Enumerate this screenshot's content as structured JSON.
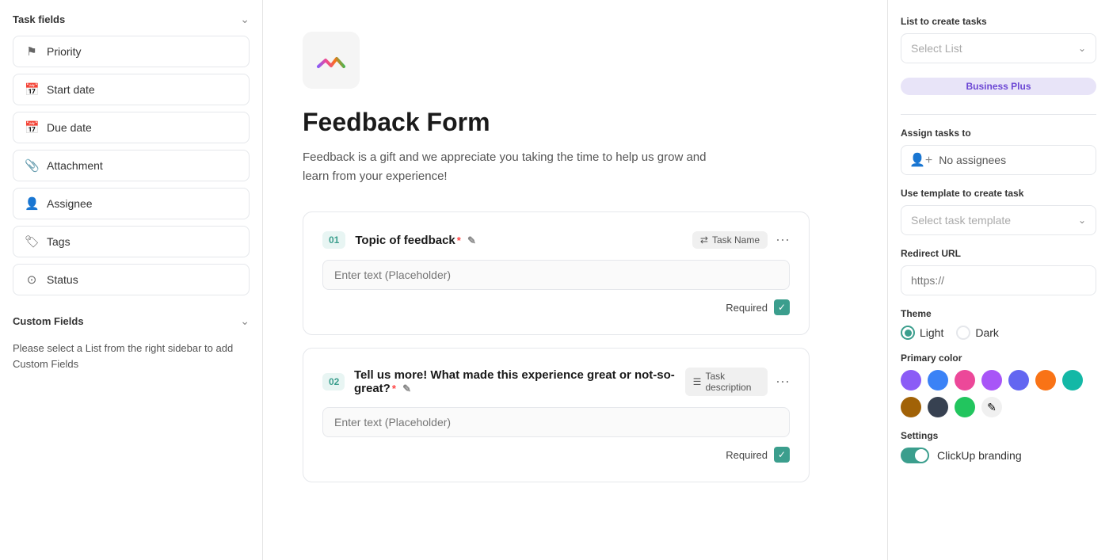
{
  "leftSidebar": {
    "taskFieldsLabel": "Task fields",
    "fields": [
      {
        "id": "priority",
        "label": "Priority",
        "icon": "⚑"
      },
      {
        "id": "start-date",
        "label": "Start date",
        "icon": "📅"
      },
      {
        "id": "due-date",
        "label": "Due date",
        "icon": "📅"
      },
      {
        "id": "attachment",
        "label": "Attachment",
        "icon": "📎"
      },
      {
        "id": "assignee",
        "label": "Assignee",
        "icon": "👤"
      },
      {
        "id": "tags",
        "label": "Tags",
        "icon": "🏷"
      },
      {
        "id": "status",
        "label": "Status",
        "icon": "⊙"
      }
    ],
    "customFieldsLabel": "Custom Fields",
    "customFieldsNote": "Please select a List from the right sidebar to add Custom Fields"
  },
  "main": {
    "formTitle": "Feedback Form",
    "formDescription": "Feedback is a gift and we appreciate you taking the time to help us grow and learn from your experience!",
    "questions": [
      {
        "number": "01",
        "title": "Topic of feedback",
        "required": true,
        "placeholder": "Enter text (Placeholder)",
        "badge": "Task Name",
        "badgeIcon": "⇄"
      },
      {
        "number": "02",
        "title": "Tell us more! What made this experience great or not-so-great?",
        "required": true,
        "placeholder": "Enter text (Placeholder)",
        "badge": "Task description",
        "badgeIcon": "☰"
      }
    ],
    "requiredLabel": "Required"
  },
  "rightSidebar": {
    "listLabel": "List to create tasks",
    "listPlaceholder": "Select List",
    "businessPlusBadge": "Business Plus",
    "assignLabel": "Assign tasks to",
    "noAssigneesLabel": "No assignees",
    "templateLabel": "Use template to create task",
    "templatePlaceholder": "Select task template",
    "redirectLabel": "Redirect URL",
    "redirectPlaceholder": "https://",
    "themeLabel": "Theme",
    "themeLight": "Light",
    "themeDark": "Dark",
    "primaryColorLabel": "Primary color",
    "colors": [
      "#8b5cf6",
      "#3b82f6",
      "#ec4899",
      "#a855f7",
      "#6366f1",
      "#f97316",
      "#14b8a6",
      "#a16207",
      "#374151",
      "#22c55e"
    ],
    "settingsLabel": "Settings",
    "clickupBrandingLabel": "ClickUp branding"
  }
}
